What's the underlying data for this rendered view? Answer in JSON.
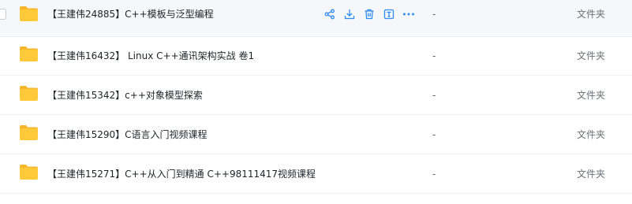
{
  "files": [
    {
      "name": "【王建伟24885】C++模板与泛型编程",
      "size": "-",
      "type": "文件夹"
    },
    {
      "name": "【王建伟16432】 Linux C++通讯架构实战 卷1",
      "size": "-",
      "type": "文件夹"
    },
    {
      "name": "【王建伟15342】c++对象模型探索",
      "size": "-",
      "type": "文件夹"
    },
    {
      "name": "【王建伟15290】C语言入门视频课程",
      "size": "-",
      "type": "文件夹"
    },
    {
      "name": "【王建伟15271】C++从入门到精通 C++98111417视频课程",
      "size": "-",
      "type": "文件夹"
    }
  ],
  "row_actions": [
    "share-icon",
    "download-icon",
    "delete-icon",
    "rename-icon",
    "more-icon"
  ],
  "colors": {
    "folder": "#ffc93a",
    "folder_tab": "#f7b52a",
    "action": "#2d8cf0",
    "hover_bg": "#f5f7fa"
  }
}
